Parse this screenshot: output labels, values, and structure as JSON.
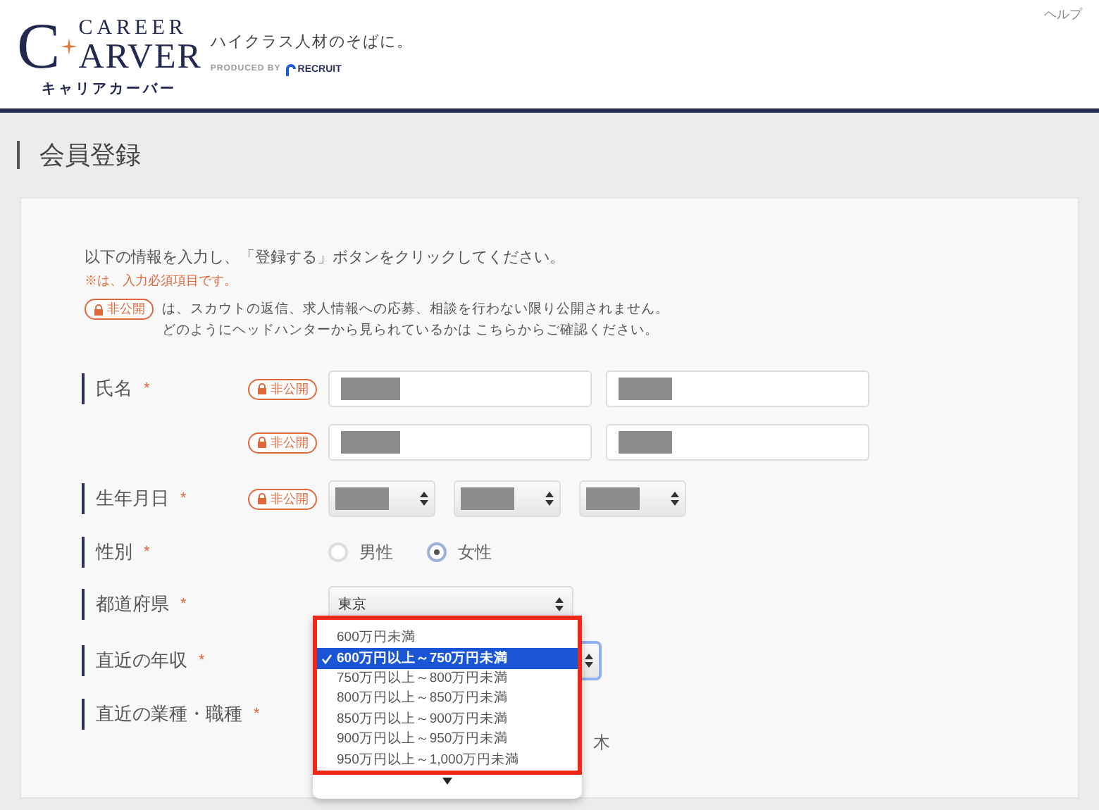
{
  "header": {
    "logo": {
      "initial": "C",
      "top": "CAREER",
      "bottom": "ARVER",
      "kana": "キャリアカーバー"
    },
    "tagline": "ハイクラス人材のそばに。",
    "produced_by": "PRODUCED BY",
    "brand": "RECRUIT",
    "help": "ヘルプ"
  },
  "page_title": "会員登録",
  "intro": {
    "instruction": "以下の情報を入力し、「登録する」ボタンをクリックしてください。",
    "required_note": "※は、入力必須項目です。",
    "private_badge": "非公開",
    "private_note": "は、スカウトの返信、求人情報への応募、相談を行わない限り公開されません。",
    "private_note_2": "どのようにヘッドハンターから見られているかは こちらからご確認ください。"
  },
  "rows": [
    {
      "kind": "text_pair",
      "label": "氏名",
      "required_mark": "*",
      "lines": [
        {
          "private_badge": "非公開",
          "redacted": true
        },
        {
          "private_badge": "非公開",
          "redacted": true
        }
      ]
    },
    {
      "kind": "date",
      "label": "生年月日",
      "required_mark": "*",
      "private_badge": "非公開",
      "selects": [
        {
          "redacted": true
        },
        {
          "redacted": true
        },
        {
          "redacted": true
        }
      ]
    },
    {
      "kind": "radio",
      "label": "性別",
      "required_mark": "*",
      "options": [
        {
          "label": "男性",
          "selected": false
        },
        {
          "label": "女性",
          "selected": true
        }
      ]
    },
    {
      "kind": "select",
      "label": "都道府県",
      "required_mark": "*",
      "value": "東京"
    },
    {
      "kind": "select_open",
      "label": "直近の年収",
      "required_mark": "*",
      "focused": true
    },
    {
      "kind": "partial",
      "label": "直近の業種・職種",
      "required_mark": "*",
      "visible_text": "木"
    }
  ],
  "dropdown": {
    "highlighted": true,
    "more_below": true,
    "options": [
      {
        "label": "600万円未満",
        "selected": false
      },
      {
        "label": "600万円以上～750万円未満",
        "selected": true
      },
      {
        "label": "750万円以上～800万円未満",
        "selected": false
      },
      {
        "label": "800万円以上～850万円未満",
        "selected": false
      },
      {
        "label": "850万円以上～900万円未満",
        "selected": false
      },
      {
        "label": "900万円以上～950万円未満",
        "selected": false
      },
      {
        "label": "950万円以上～1,000万円未満",
        "selected": false
      }
    ]
  }
}
